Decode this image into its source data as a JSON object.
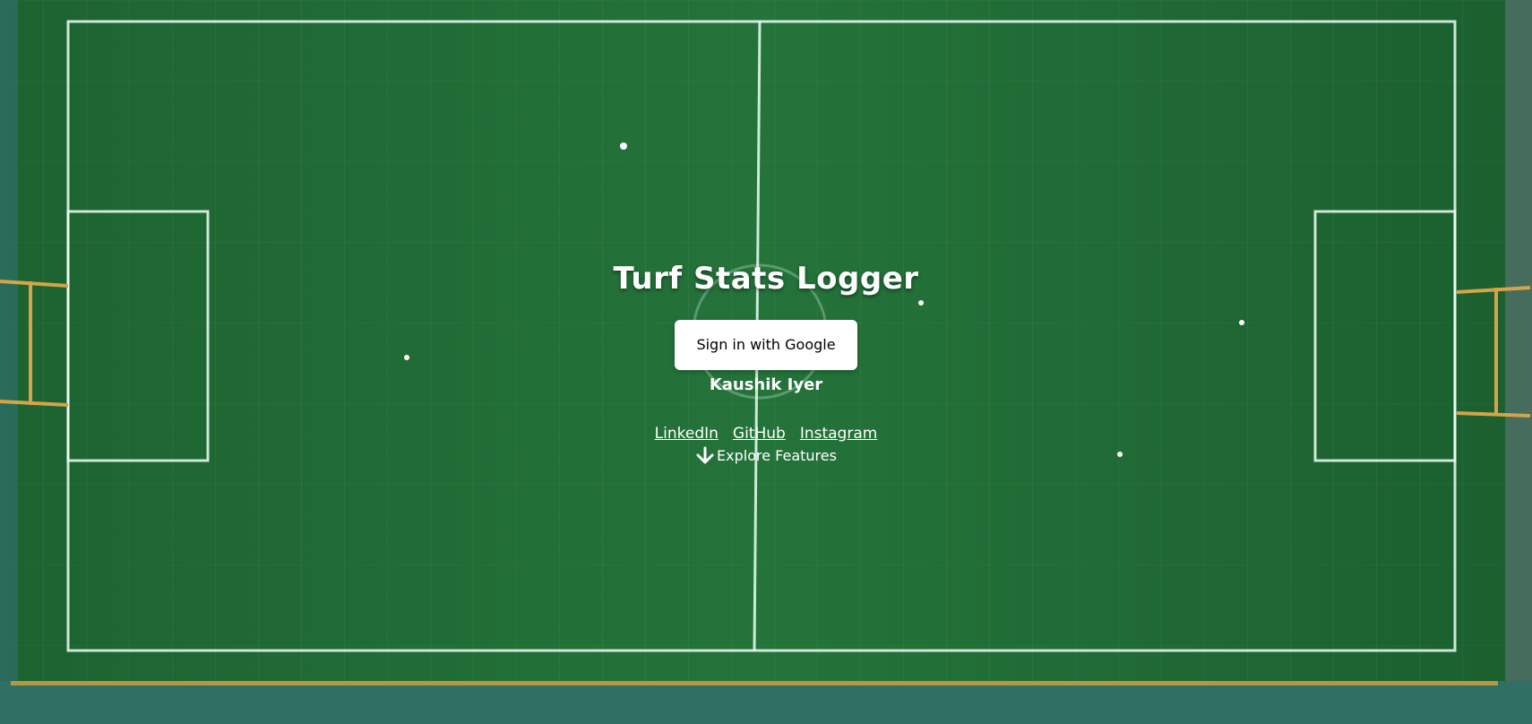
{
  "hero": {
    "title": "Turf Stats Logger",
    "signin_label": "Sign in with Google",
    "author": "Kaushik Iyer",
    "links": [
      "LinkedIn",
      "GitHub",
      "Instagram"
    ],
    "explore_label": "Explore Features"
  },
  "icons": {
    "explore": "arrow-down-icon"
  },
  "colors": {
    "turf": "#1f6a36",
    "button_bg": "#ffffff",
    "button_text": "#000000",
    "text": "#ffffff"
  }
}
